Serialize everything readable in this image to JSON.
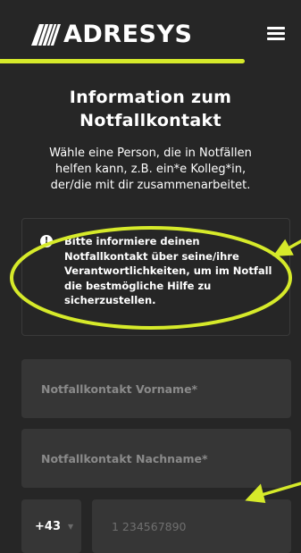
{
  "header": {
    "brand": "ADRESYS",
    "menu_icon": "hamburger-menu-icon"
  },
  "colors": {
    "background": "#262626",
    "accent": "#d6ea2a",
    "field_background": "#363636"
  },
  "page": {
    "title_line1": "Information zum",
    "title_line2": "Notfallkontakt",
    "intro_line1": "Wähle eine Person, die in Notfällen",
    "intro_line2": "helfen kann, z.B. ein*e Kolleg*in,",
    "intro_line3": "der/die mit dir zusammenarbeitet."
  },
  "info": {
    "icon": "info-icon",
    "line1": "Bitte informiere deinen",
    "line2": "Notfallkontakt über seine/ihre",
    "line3": "Verantwortlichkeiten, um im Notfall",
    "line4": "die bestmögliche Hilfe zu",
    "line5": "sicherzustellen."
  },
  "form": {
    "first_name_placeholder": "Notfallkontakt Vorname*",
    "last_name_placeholder": "Notfallkontakt Nachname*",
    "phone_code": "+43",
    "phone_placeholder": "1 234567890"
  }
}
